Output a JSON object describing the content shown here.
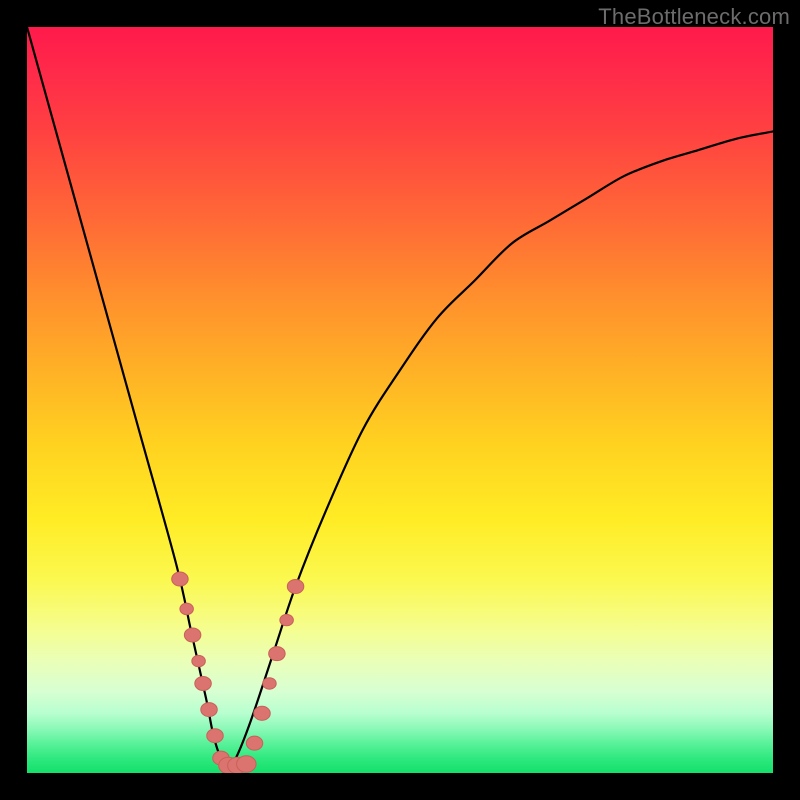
{
  "watermark": "TheBottleneck.com",
  "colors": {
    "frame": "#000000",
    "curve_stroke": "#000000",
    "marker_fill": "#db746e",
    "marker_stroke": "#c9605a"
  },
  "chart_data": {
    "type": "line",
    "title": "",
    "xlabel": "",
    "ylabel": "",
    "xlim": [
      0,
      100
    ],
    "ylim": [
      0,
      100
    ],
    "grid": false,
    "series": [
      {
        "name": "bottleneck-curve",
        "x": [
          0,
          5,
          10,
          15,
          20,
          22,
          24,
          25,
          26,
          27,
          28,
          30,
          33,
          36,
          40,
          45,
          50,
          55,
          60,
          65,
          70,
          75,
          80,
          85,
          90,
          95,
          100
        ],
        "y": [
          100,
          82,
          64,
          46,
          28,
          19,
          10,
          5,
          2,
          1,
          2,
          7,
          16,
          25,
          35,
          46,
          54,
          61,
          66,
          71,
          74,
          77,
          80,
          82,
          83.5,
          85,
          86
        ]
      }
    ],
    "markers": [
      {
        "x": 20.5,
        "y": 26,
        "r": 1.1
      },
      {
        "x": 21.4,
        "y": 22,
        "r": 0.9
      },
      {
        "x": 22.2,
        "y": 18.5,
        "r": 1.1
      },
      {
        "x": 23.0,
        "y": 15,
        "r": 0.9
      },
      {
        "x": 23.6,
        "y": 12,
        "r": 1.1
      },
      {
        "x": 24.4,
        "y": 8.5,
        "r": 1.1
      },
      {
        "x": 25.2,
        "y": 5,
        "r": 1.1
      },
      {
        "x": 26.0,
        "y": 2,
        "r": 1.1
      },
      {
        "x": 27.0,
        "y": 1,
        "r": 1.3
      },
      {
        "x": 28.2,
        "y": 1,
        "r": 1.3
      },
      {
        "x": 29.4,
        "y": 1.2,
        "r": 1.3
      },
      {
        "x": 30.5,
        "y": 4,
        "r": 1.1
      },
      {
        "x": 31.5,
        "y": 8,
        "r": 1.1
      },
      {
        "x": 32.5,
        "y": 12,
        "r": 0.9
      },
      {
        "x": 33.5,
        "y": 16,
        "r": 1.1
      },
      {
        "x": 34.8,
        "y": 20.5,
        "r": 0.9
      },
      {
        "x": 36.0,
        "y": 25,
        "r": 1.1
      }
    ]
  }
}
